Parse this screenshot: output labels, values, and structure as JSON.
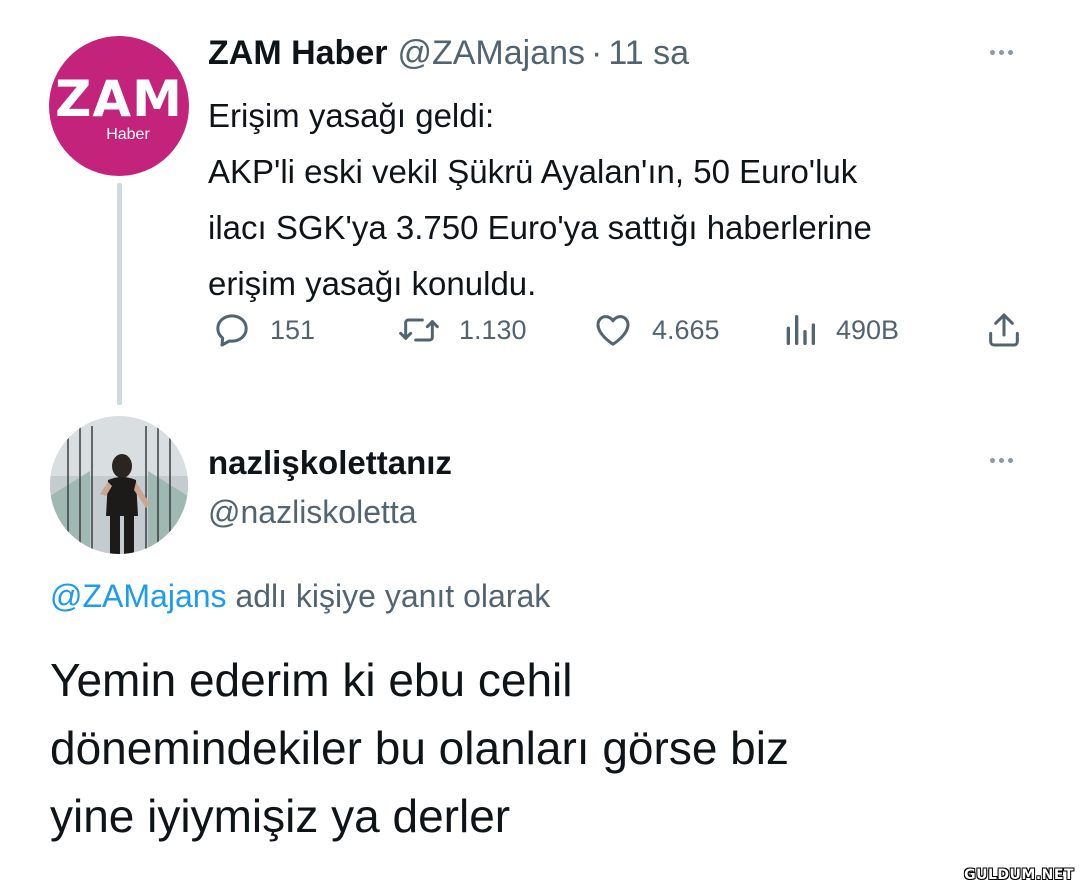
{
  "tweet1": {
    "avatar": {
      "logo_text": "ZAM",
      "logo_sub": "Haber",
      "color": "#c3237a"
    },
    "display_name": "ZAM Haber",
    "handle": "@ZAMajans",
    "separator": "·",
    "time": "11 sa",
    "body_lines": [
      "Erişim yasağı geldi:",
      "AKP'li eski vekil Şükrü Ayalan'ın, 50 Euro'luk",
      "ilacı SGK'ya 3.750 Euro'ya sattığı haberlerine",
      "erişim yasağı konuldu."
    ],
    "actions": {
      "reply": {
        "icon": "reply-icon",
        "count": "151"
      },
      "retweet": {
        "icon": "retweet-icon",
        "count": "1.130"
      },
      "like": {
        "icon": "heart-icon",
        "count": "4.665"
      },
      "views": {
        "icon": "analytics-icon",
        "count": "490B"
      },
      "share": {
        "icon": "share-icon"
      }
    }
  },
  "tweet2": {
    "display_name": "nazlişkolettanız",
    "handle": "@nazliskoletta",
    "reply_context": {
      "mention": "@ZAMajans",
      "text": " adlı kişiye yanıt olarak"
    },
    "body_lines": [
      "Yemin ederim ki ebu cehil",
      "dönemindekiler bu olanları görse biz",
      "yine iyiymişiz ya derler"
    ]
  },
  "colors": {
    "primary_text": "#0f1419",
    "secondary_text": "#536471",
    "mention": "#1d9bf0",
    "thread_line": "#cfd9de"
  },
  "watermark": "GULDUM.NET"
}
